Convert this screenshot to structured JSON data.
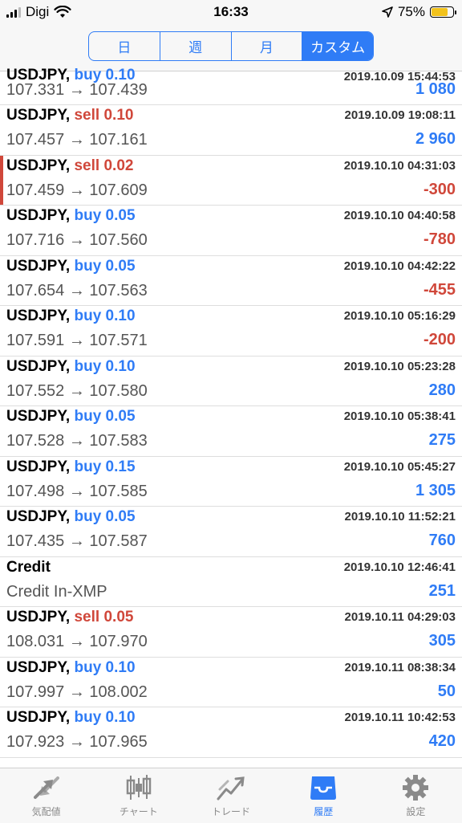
{
  "status_bar": {
    "carrier": "Digi",
    "time": "16:33",
    "battery": "75%",
    "battery_level": 0.75
  },
  "segments": [
    {
      "label": "日",
      "active": false
    },
    {
      "label": "週",
      "active": false
    },
    {
      "label": "月",
      "active": false
    },
    {
      "label": "カスタム",
      "active": true
    }
  ],
  "trades": [
    {
      "symbol": "USDJPY,",
      "side": "buy",
      "volume": "0.10",
      "time": "2019.10.09 15:44:53",
      "prices": "107.331 → 107.439",
      "profit": "1 080",
      "sign": "pos"
    },
    {
      "symbol": "USDJPY,",
      "side": "sell",
      "volume": "0.10",
      "time": "2019.10.09 19:08:11",
      "prices": "107.457 → 107.161",
      "profit": "2 960",
      "sign": "pos"
    },
    {
      "symbol": "USDJPY,",
      "side": "sell",
      "volume": "0.02",
      "time": "2019.10.10 04:31:03",
      "prices": "107.459 → 107.609",
      "profit": "-300",
      "sign": "neg"
    },
    {
      "symbol": "USDJPY,",
      "side": "buy",
      "volume": "0.05",
      "time": "2019.10.10 04:40:58",
      "prices": "107.716 → 107.560",
      "profit": "-780",
      "sign": "neg"
    },
    {
      "symbol": "USDJPY,",
      "side": "buy",
      "volume": "0.05",
      "time": "2019.10.10 04:42:22",
      "prices": "107.654 → 107.563",
      "profit": "-455",
      "sign": "neg"
    },
    {
      "symbol": "USDJPY,",
      "side": "buy",
      "volume": "0.10",
      "time": "2019.10.10 05:16:29",
      "prices": "107.591 → 107.571",
      "profit": "-200",
      "sign": "neg"
    },
    {
      "symbol": "USDJPY,",
      "side": "buy",
      "volume": "0.10",
      "time": "2019.10.10 05:23:28",
      "prices": "107.552 → 107.580",
      "profit": "280",
      "sign": "pos"
    },
    {
      "symbol": "USDJPY,",
      "side": "buy",
      "volume": "0.05",
      "time": "2019.10.10 05:38:41",
      "prices": "107.528 → 107.583",
      "profit": "275",
      "sign": "pos"
    },
    {
      "symbol": "USDJPY,",
      "side": "buy",
      "volume": "0.15",
      "time": "2019.10.10 05:45:27",
      "prices": "107.498 → 107.585",
      "profit": "1 305",
      "sign": "pos"
    },
    {
      "symbol": "USDJPY,",
      "side": "buy",
      "volume": "0.05",
      "time": "2019.10.10 11:52:21",
      "prices": "107.435 → 107.587",
      "profit": "760",
      "sign": "pos"
    },
    {
      "symbol": "Credit",
      "side": "",
      "volume": "",
      "time": "2019.10.10 12:46:41",
      "prices": "Credit In-XMP",
      "profit": "251",
      "sign": "pos"
    },
    {
      "symbol": "USDJPY,",
      "side": "sell",
      "volume": "0.05",
      "time": "2019.10.11 04:29:03",
      "prices": "108.031 → 107.970",
      "profit": "305",
      "sign": "pos"
    },
    {
      "symbol": "USDJPY,",
      "side": "buy",
      "volume": "0.10",
      "time": "2019.10.11 08:38:34",
      "prices": "107.997 → 108.002",
      "profit": "50",
      "sign": "pos"
    },
    {
      "symbol": "USDJPY,",
      "side": "buy",
      "volume": "0.10",
      "time": "2019.10.11 10:42:53",
      "prices": "107.923 → 107.965",
      "profit": "420",
      "sign": "pos"
    }
  ],
  "tabs": [
    {
      "label": "気配値",
      "icon": "quotes-arrows-icon",
      "active": false
    },
    {
      "label": "チャート",
      "icon": "candlestick-chart-icon",
      "active": false
    },
    {
      "label": "トレード",
      "icon": "trade-line-icon",
      "active": false
    },
    {
      "label": "履歴",
      "icon": "history-inbox-icon",
      "active": true
    },
    {
      "label": "設定",
      "icon": "gear-icon",
      "active": false
    }
  ],
  "colors": {
    "accent": "#2f7cf6",
    "loss": "#d0473a"
  }
}
